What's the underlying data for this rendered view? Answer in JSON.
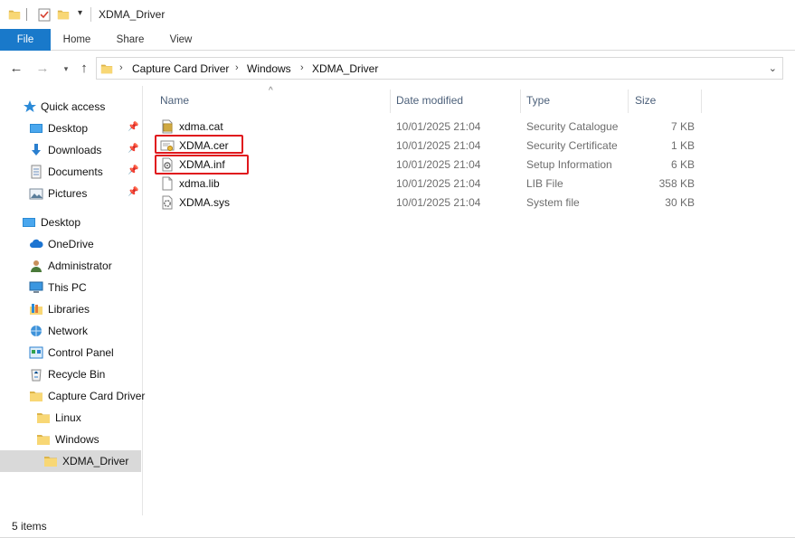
{
  "window": {
    "title": "XDMA_Driver"
  },
  "ribbon": {
    "tabs": [
      "File",
      "Home",
      "Share",
      "View"
    ]
  },
  "address": {
    "crumbs": [
      "Capture Card Driver",
      "Windows",
      "XDMA_Driver"
    ]
  },
  "nav": {
    "items": [
      {
        "label": "Quick access",
        "icon": "star-icon",
        "pinned": false
      },
      {
        "label": "Desktop",
        "icon": "desktop-icon",
        "pinned": true
      },
      {
        "label": "Downloads",
        "icon": "download-icon",
        "pinned": true
      },
      {
        "label": "Documents",
        "icon": "documents-icon",
        "pinned": true
      },
      {
        "label": "Pictures",
        "icon": "pictures-icon",
        "pinned": true
      },
      {
        "label": "Desktop",
        "icon": "desktop-icon",
        "pinned": false
      },
      {
        "label": "OneDrive",
        "icon": "cloud-icon",
        "pinned": false
      },
      {
        "label": "Administrator",
        "icon": "user-icon",
        "pinned": false
      },
      {
        "label": "This PC",
        "icon": "pc-icon",
        "pinned": false
      },
      {
        "label": "Libraries",
        "icon": "libraries-icon",
        "pinned": false
      },
      {
        "label": "Network",
        "icon": "network-icon",
        "pinned": false
      },
      {
        "label": "Control Panel",
        "icon": "control-panel-icon",
        "pinned": false
      },
      {
        "label": "Recycle Bin",
        "icon": "recycle-bin-icon",
        "pinned": false
      },
      {
        "label": "Capture Card Driver",
        "icon": "folder-icon",
        "pinned": false
      },
      {
        "label": "Linux",
        "icon": "folder-icon",
        "pinned": false
      },
      {
        "label": "Windows",
        "icon": "folder-icon",
        "pinned": false
      },
      {
        "label": "XDMA_Driver",
        "icon": "folder-icon",
        "pinned": false,
        "selected": true
      }
    ]
  },
  "columns": {
    "name": "Name",
    "date": "Date modified",
    "type": "Type",
    "size": "Size"
  },
  "files": [
    {
      "name": "xdma.cat",
      "date": "10/01/2025 21:04",
      "type": "Security Catalogue",
      "size": "7 KB",
      "icon": "catalog-file-icon",
      "highlighted": false
    },
    {
      "name": "XDMA.cer",
      "date": "10/01/2025 21:04",
      "type": "Security Certificate",
      "size": "1 KB",
      "icon": "certificate-file-icon",
      "highlighted": true
    },
    {
      "name": "XDMA.inf",
      "date": "10/01/2025 21:04",
      "type": "Setup Information",
      "size": "6 KB",
      "icon": "setup-info-file-icon",
      "highlighted": true
    },
    {
      "name": "xdma.lib",
      "date": "10/01/2025 21:04",
      "type": "LIB File",
      "size": "358 KB",
      "icon": "blank-file-icon",
      "highlighted": false
    },
    {
      "name": "XDMA.sys",
      "date": "10/01/2025 21:04",
      "type": "System file",
      "size": "30 KB",
      "icon": "system-file-icon",
      "highlighted": false
    }
  ],
  "status": {
    "item_count": "5 items"
  },
  "colors": {
    "accent": "#1979ca",
    "highlight": "#e0171d",
    "folder": "#f8d775",
    "selection": "#d9d9d9"
  }
}
